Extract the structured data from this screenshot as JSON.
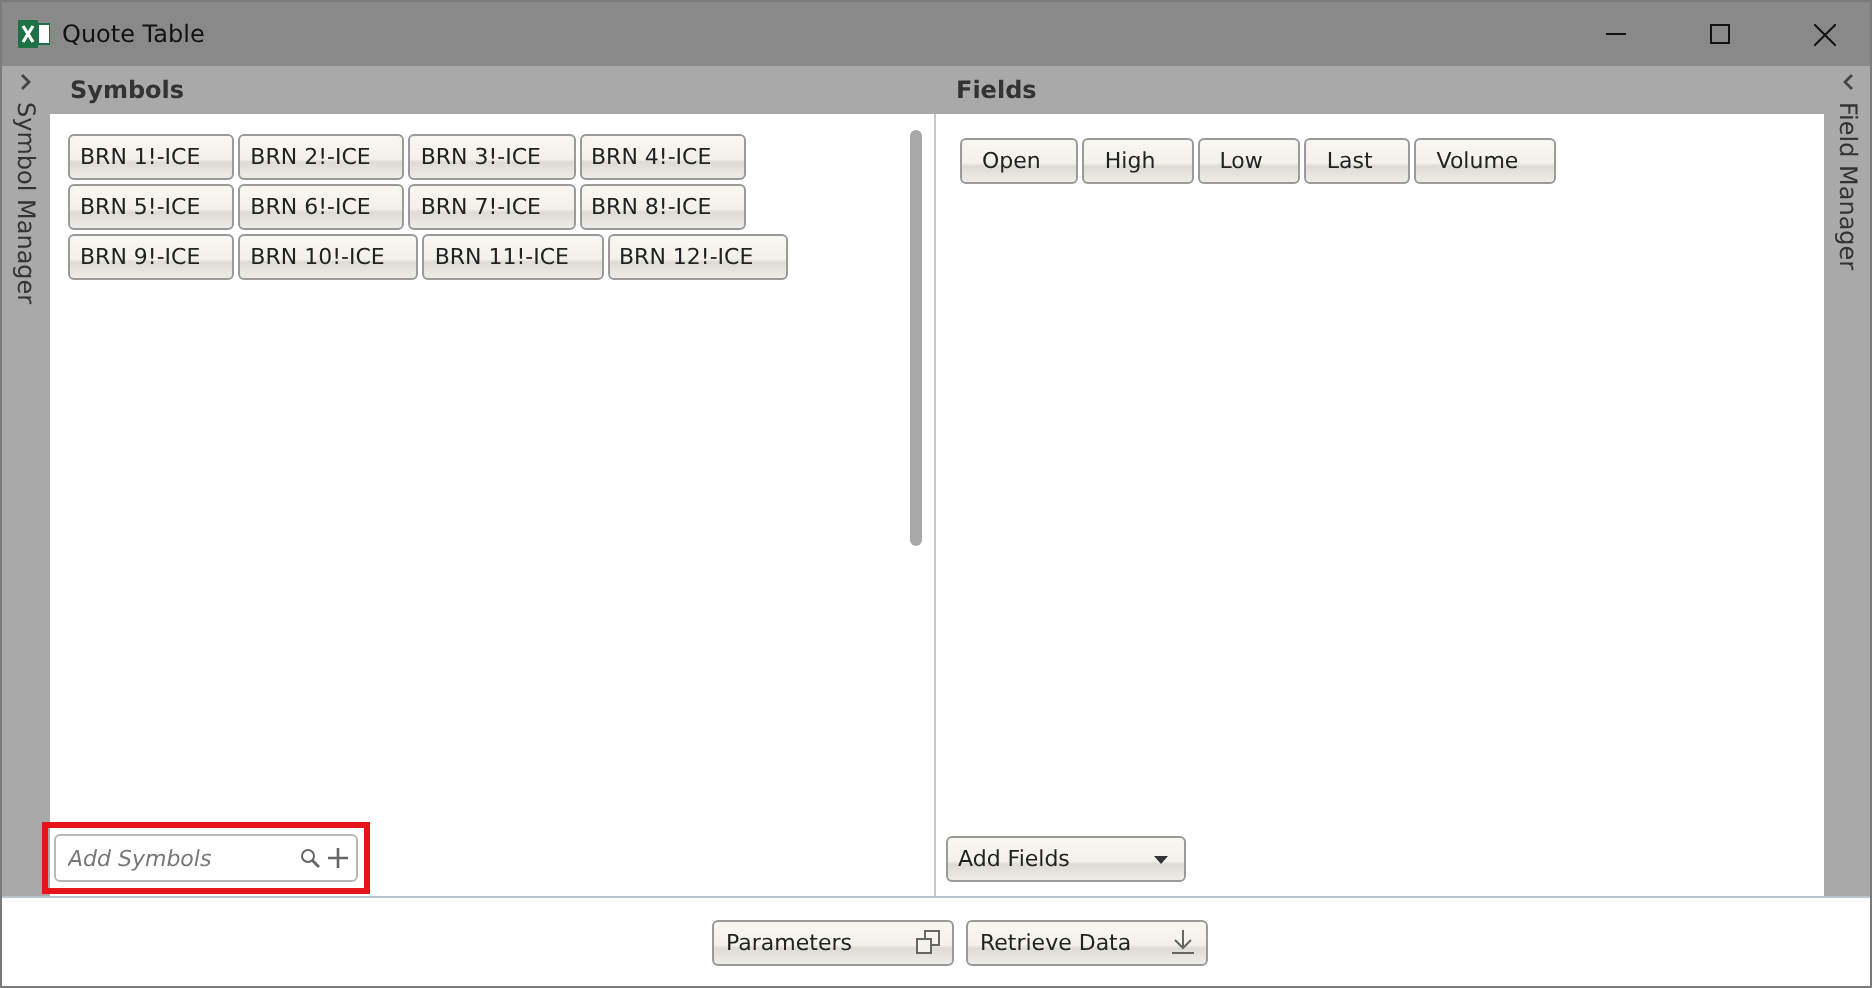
{
  "window": {
    "title": "Quote Table"
  },
  "left_sidebar": {
    "label": "Symbol Manager",
    "collapsed": true
  },
  "right_sidebar": {
    "label": "Field Manager",
    "collapsed": true
  },
  "symbols": {
    "heading": "Symbols",
    "items": [
      "BRN 1!-ICE",
      "BRN 2!-ICE",
      "BRN 3!-ICE",
      "BRN 4!-ICE",
      "BRN 5!-ICE",
      "BRN 6!-ICE",
      "BRN 7!-ICE",
      "BRN 8!-ICE",
      "BRN 9!-ICE",
      "BRN 10!-ICE",
      "BRN 11!-ICE",
      "BRN 12!-ICE"
    ],
    "search": {
      "placeholder": "Add Symbols",
      "highlighted": true
    }
  },
  "fields": {
    "heading": "Fields",
    "items": [
      "Open",
      "High",
      "Low",
      "Last",
      "Volume"
    ],
    "add_button": "Add Fields"
  },
  "footer_buttons": [
    {
      "label": "Parameters",
      "kind": "popout"
    },
    {
      "label": "Retrieve Data",
      "kind": "download"
    }
  ]
}
